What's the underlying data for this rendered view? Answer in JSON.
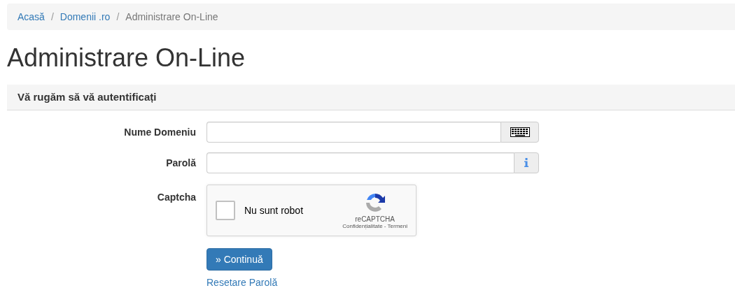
{
  "breadcrumb": [
    {
      "label": "Acasă",
      "kind": "link"
    },
    {
      "separator": "/",
      "label": "Domenii .ro",
      "kind": "link"
    },
    {
      "separator": "/",
      "label": "Administrare On-Line",
      "kind": "current"
    }
  ],
  "title": "Administrare On-Line",
  "panel": {
    "heading": "Vă rugăm să vă autentificați"
  },
  "fields": [
    {
      "label": "Nume Domeniu",
      "kind": "keyboard"
    },
    {
      "label": "Parolă",
      "kind": "info"
    }
  ],
  "captcha": {
    "label": "Captcha",
    "checkbox_label": "Nu sunt robot",
    "checked": false,
    "brand": "reCAPTCHA",
    "legal": "Confidențialitate - Termeni"
  },
  "submit": "» Continuă",
  "reset_link": "Resetare Parolă"
}
